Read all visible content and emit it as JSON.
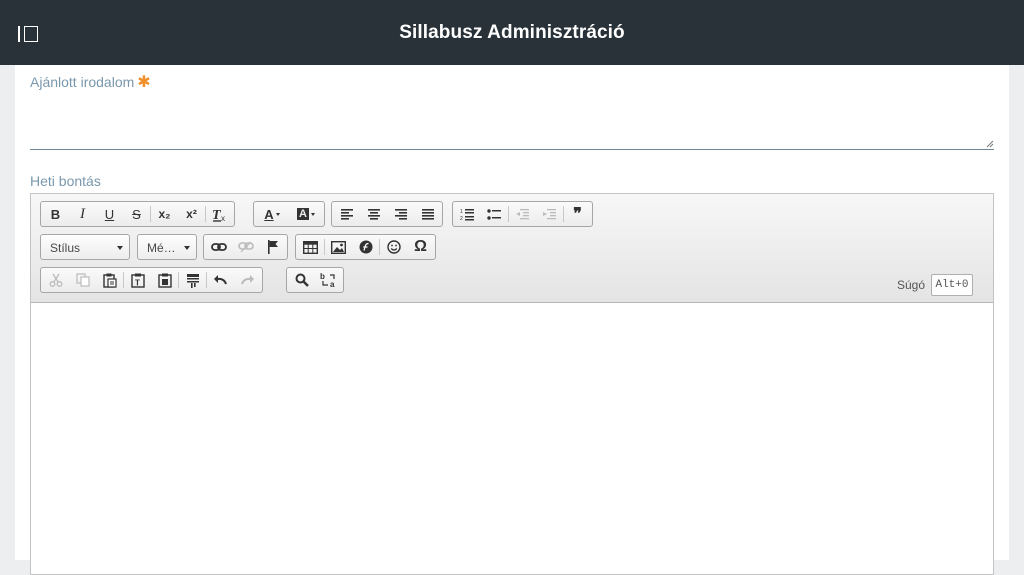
{
  "header": {
    "title": "Sillabusz Adminisztráció",
    "menu_icon": "sidebar-toggle-icon"
  },
  "fields": {
    "literature": {
      "label": "Ajánlott irodalom",
      "required_mark": "✱",
      "value": ""
    },
    "weekly": {
      "label": "Heti bontás"
    }
  },
  "editor": {
    "toolbar": {
      "row1": [
        {
          "name": "bold",
          "glyph": "B"
        },
        {
          "name": "italic",
          "glyph": "I"
        },
        {
          "name": "underline",
          "glyph": "U"
        },
        {
          "name": "strikethrough",
          "glyph": "S"
        },
        {
          "name": "subscript",
          "glyph": "x₂"
        },
        {
          "name": "superscript",
          "glyph": "x²"
        },
        {
          "name": "remove-format",
          "glyph": "Tx"
        },
        {
          "name": "text-color",
          "glyph": "A"
        },
        {
          "name": "background-color",
          "glyph": "A"
        },
        {
          "name": "align-left",
          "glyph": "≡"
        },
        {
          "name": "align-center",
          "glyph": "≡"
        },
        {
          "name": "align-right",
          "glyph": "≡"
        },
        {
          "name": "justify",
          "glyph": "≡"
        },
        {
          "name": "numbered-list",
          "glyph": "1≡"
        },
        {
          "name": "bulleted-list",
          "glyph": "•≡"
        },
        {
          "name": "decrease-indent",
          "glyph": "⇤"
        },
        {
          "name": "increase-indent",
          "glyph": "⇥"
        },
        {
          "name": "blockquote",
          "glyph": "❞"
        }
      ],
      "style_combo": "Stílus",
      "size_combo": "Mé…",
      "help_label": "Súgó",
      "help_key": "Alt+0"
    },
    "content": ""
  },
  "colors": {
    "header_bg": "#283238",
    "label": "#7a98ad",
    "required": "#f0902a"
  }
}
